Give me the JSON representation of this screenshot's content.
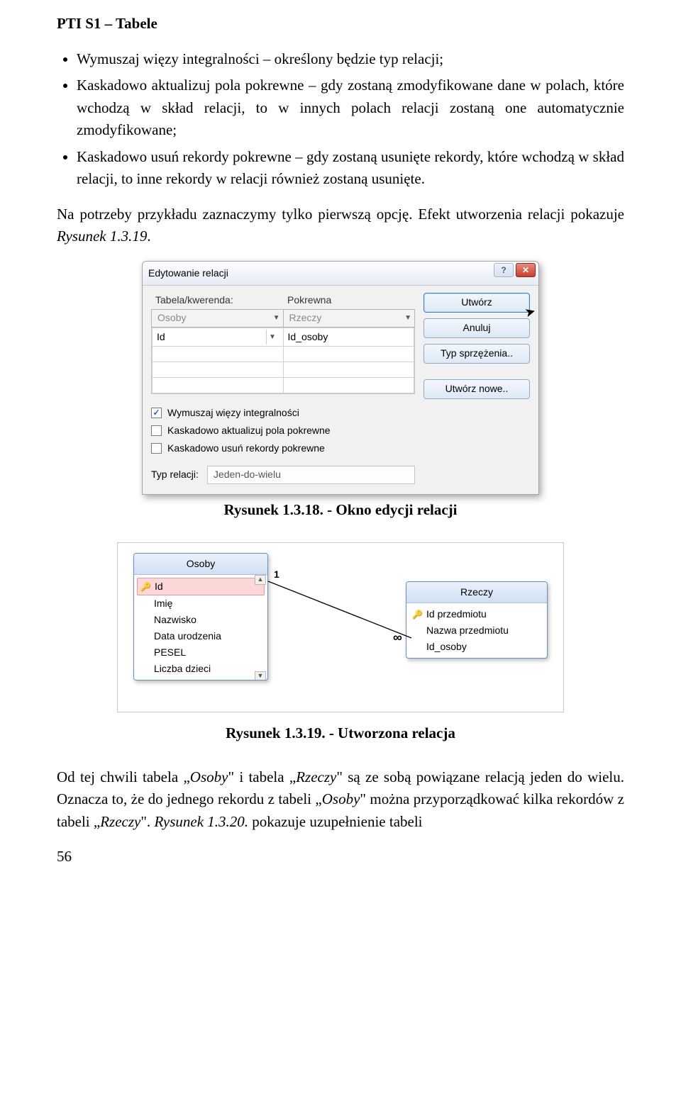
{
  "header": "PTI S1 – Tabele",
  "bullets": [
    "Wymuszaj więzy integralności – określony będzie typ relacji;",
    "Kaskadowo aktualizuj pola pokrewne – gdy zostaną zmodyfikowane dane w polach, które wchodzą w skład relacji, to w innych polach relacji zostaną one automatycznie zmodyfikowane;",
    "Kaskadowo usuń rekordy pokrewne – gdy zostaną usunięte rekordy, które wchodzą w skład relacji, to inne rekordy w relacji również zostaną usunięte."
  ],
  "para1_a": "Na potrzeby przykładu zaznaczymy tylko pierwszą opcję. Efekt utworzenia relacji pokazuje ",
  "para1_b": "Rysunek 1.3.19",
  "para1_c": ".",
  "dialog": {
    "title": "Edytowanie relacji",
    "help_glyph": "?",
    "close_glyph": "✕",
    "col1_label": "Tabela/kwerenda:",
    "col2_label": "Pokrewna",
    "combo1": "Osoby",
    "combo2": "Rzeczy",
    "field1": "Id",
    "field2": "Id_osoby",
    "chk1": "Wymuszaj więzy integralności",
    "chk2": "Kaskadowo aktualizuj pola pokrewne",
    "chk3": "Kaskadowo usuń rekordy pokrewne",
    "typ_label": "Typ relacji:",
    "typ_value": "Jeden-do-wielu",
    "btn_create": "Utwórz",
    "btn_cancel": "Anuluj",
    "btn_join": "Typ sprzężenia..",
    "btn_new": "Utwórz nowe.."
  },
  "caption1": "Rysunek 1.3.18. - Okno edycji relacji",
  "rel": {
    "t1_title": "Osoby",
    "t1_fields": [
      "Id",
      "Imię",
      "Nazwisko",
      "Data urodzenia",
      "PESEL",
      "Liczba dzieci"
    ],
    "t2_title": "Rzeczy",
    "t2_fields": [
      "Id przedmiotu",
      "Nazwa przedmiotu",
      "Id_osoby"
    ],
    "one": "1",
    "many": "∞"
  },
  "caption2": "Rysunek 1.3.19. - Utworzona relacja",
  "para2_a": "Od tej chwili tabela „",
  "para2_b": "Osoby",
  "para2_c": "\" i tabela „",
  "para2_d": "Rzeczy",
  "para2_e": "\" są ze sobą powiązane relacją jeden do wielu. Oznacza to, że do jednego rekordu z tabeli „",
  "para2_f": "Osoby",
  "para2_g": "\" można przyporządkować kilka rekordów z tabeli „",
  "para2_h": "Rzeczy",
  "para2_i": "\". ",
  "para2_j": "Rysunek 1.3.20.",
  "para2_k": " pokazuje uzupełnienie tabeli",
  "pagenum": "56"
}
